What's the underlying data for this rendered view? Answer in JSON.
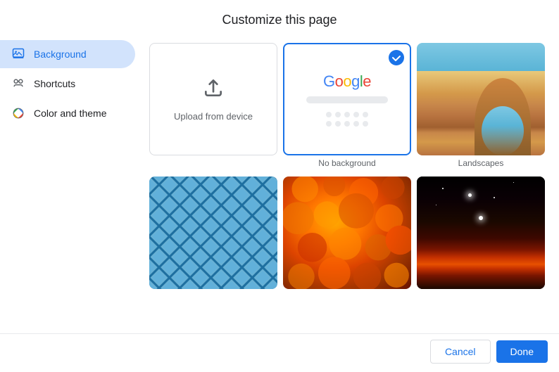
{
  "dialog": {
    "title": "Customize this page"
  },
  "sidebar": {
    "items": [
      {
        "id": "background",
        "label": "Background",
        "active": true
      },
      {
        "id": "shortcuts",
        "label": "Shortcuts",
        "active": false
      },
      {
        "id": "color-and-theme",
        "label": "Color and theme",
        "active": false
      }
    ]
  },
  "grid": {
    "items": [
      {
        "id": "upload",
        "type": "upload",
        "label": "Upload from device"
      },
      {
        "id": "no-background",
        "type": "no-background",
        "label": "No background",
        "selected": true
      },
      {
        "id": "landscapes",
        "type": "photo",
        "label": "Landscapes",
        "theme": "landscape"
      },
      {
        "id": "architecture",
        "type": "photo",
        "label": "",
        "theme": "architecture"
      },
      {
        "id": "nature",
        "type": "photo",
        "label": "",
        "theme": "nature"
      },
      {
        "id": "space",
        "type": "photo",
        "label": "",
        "theme": "space"
      }
    ]
  },
  "footer": {
    "cancel_label": "Cancel",
    "done_label": "Done"
  },
  "icons": {
    "background": "🖼",
    "shortcuts": "🔗",
    "color_theme": "🎨",
    "upload_arrow": "↑",
    "checkmark": "✓"
  }
}
